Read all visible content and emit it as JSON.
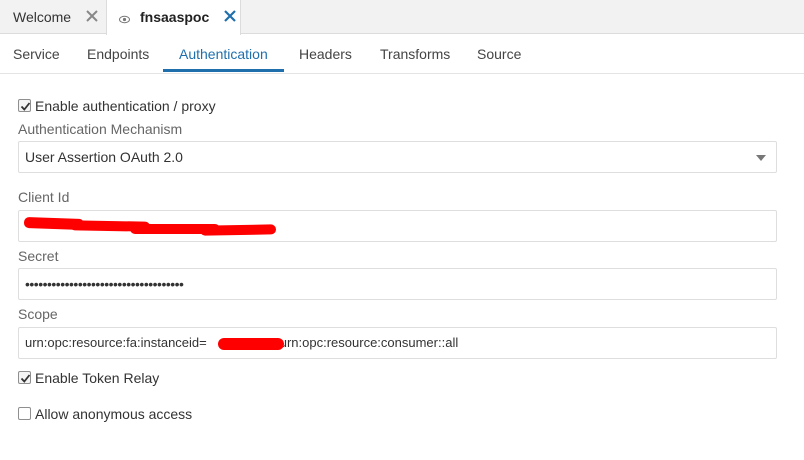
{
  "editor_tabs": [
    {
      "label": "Welcome",
      "close_icon": "close-icon"
    },
    {
      "label": "fnsaaspoc",
      "icon": "eye-icon",
      "close_icon": "close-icon",
      "active": true
    }
  ],
  "sub_tabs": [
    "Service",
    "Endpoints",
    "Authentication",
    "Headers",
    "Transforms",
    "Source"
  ],
  "active_sub_tab": "Authentication",
  "form": {
    "enable_auth_label": "Enable authentication / proxy",
    "enable_auth_checked": true,
    "mechanism_label": "Authentication Mechanism",
    "mechanism_value": "User Assertion OAuth 2.0",
    "client_id_label": "Client Id",
    "client_id_value": "",
    "secret_label": "Secret",
    "secret_value": "••••••••••••••••••••••••••••••••••••",
    "scope_label": "Scope",
    "scope_prefix": "urn:opc:resource:fa:instanceid=",
    "scope_suffix": "urn:opc:resource:consumer::all",
    "token_relay_label": "Enable Token Relay",
    "token_relay_checked": true,
    "anonymous_label": "Allow anonymous access",
    "anonymous_checked": false
  },
  "colors": {
    "accent": "#1f6fad",
    "close_icon": "#888888",
    "active_close_icon": "#1f6fad",
    "redaction": "#ff0000"
  }
}
